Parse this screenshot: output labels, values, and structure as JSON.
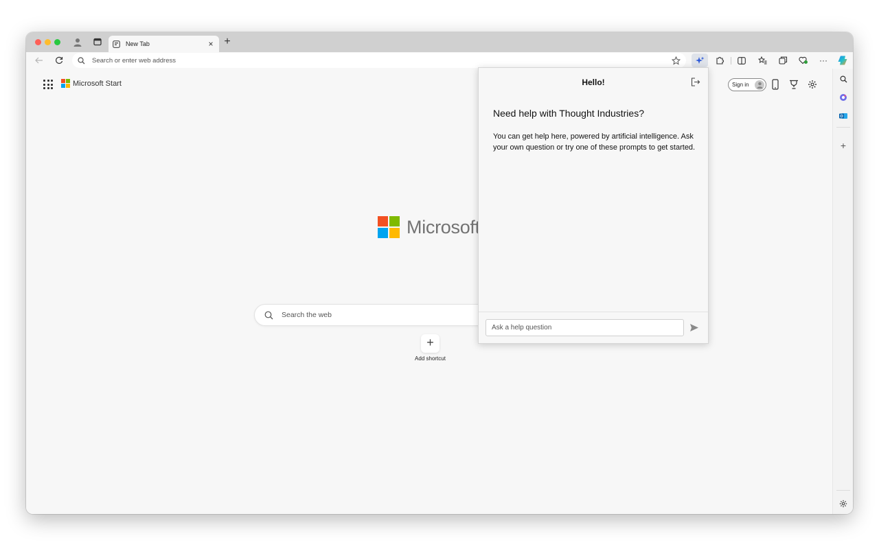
{
  "browser": {
    "tab": {
      "title": "New Tab",
      "close_label": "×"
    },
    "new_tab_label": "+",
    "address_bar": {
      "placeholder": "Search or enter web address"
    },
    "more_label": "···"
  },
  "new_tab_page": {
    "brand": "Microsoft Start",
    "logo_text": "Microsoft",
    "search_placeholder": "Search the web",
    "add_shortcut_symbol": "+",
    "add_shortcut_label": "Add shortcut",
    "sign_in_label": "Sign in",
    "logo_colors": [
      "#f25022",
      "#7fba00",
      "#00a4ef",
      "#ffb900"
    ]
  },
  "sidebar": {
    "add_label": "+"
  },
  "help_panel": {
    "title": "Hello!",
    "heading": "Need help with Thought Industries?",
    "body": "You can get help here, powered by artificial intelligence. Ask your own question or try one of these prompts to get started.",
    "input_placeholder": "Ask a help question"
  }
}
